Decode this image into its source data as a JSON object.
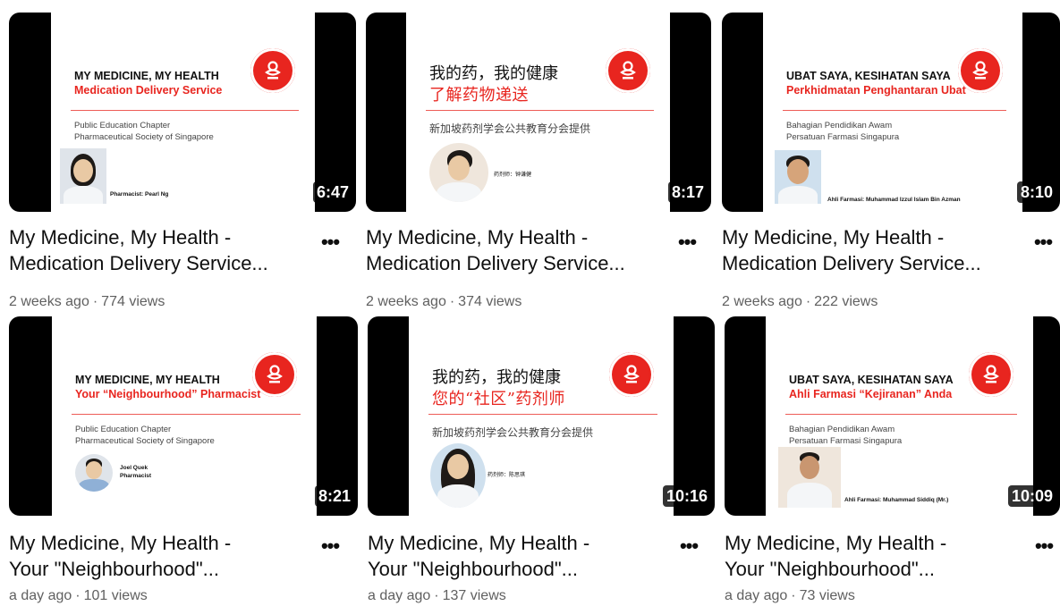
{
  "videos": [
    {
      "title_l1": "My Medicine, My Health -",
      "title_l2": "Medication Delivery Service...",
      "age": "2 weeks ago",
      "views": "774 views",
      "duration": "6:47",
      "thumbnail": {
        "heading": "MY MEDICINE, MY HEALTH",
        "subheading": "Medication Delivery Service",
        "org_line1": "Public Education Chapter",
        "org_line2": "Pharmaceutical Society of Singapore",
        "caption": "Pharmacist: Pearl Ng",
        "caption2": ""
      }
    },
    {
      "title_l1": "My Medicine, My Health -",
      "title_l2": "Medication Delivery Service...",
      "age": "2 weeks ago",
      "views": "374 views",
      "duration": "8:17",
      "thumbnail": {
        "heading": "我的药，我的健康",
        "subheading": "了解药物递送",
        "org_line1": "新加坡药剂学会公共教育分会提供",
        "org_line2": "",
        "caption": "药剂师：钟谦健",
        "caption2": ""
      }
    },
    {
      "title_l1": "My Medicine, My Health -",
      "title_l2": "Medication Delivery Service...",
      "age": "2 weeks ago",
      "views": "222 views",
      "duration": "8:10",
      "thumbnail": {
        "heading": "UBAT SAYA, KESIHATAN SAYA",
        "subheading": "Perkhidmatan Penghantaran Ubat",
        "org_line1": "Bahagian Pendidikan Awam",
        "org_line2": "Persatuan Farmasi Singapura",
        "caption": "Ahli Farmasi: Muhammad Izzul Islam Bin Azman",
        "caption2": ""
      }
    },
    {
      "title_l1": "My Medicine, My Health -",
      "title_l2": "Your \"Neighbourhood\"...",
      "age": "a day ago",
      "views": "101 views",
      "duration": "8:21",
      "thumbnail": {
        "heading": "MY MEDICINE, MY HEALTH",
        "subheading": "Your “Neighbourhood” Pharmacist",
        "org_line1": "Public Education Chapter",
        "org_line2": "Pharmaceutical Society of Singapore",
        "caption": "Joel Quek",
        "caption2": "Pharmacist"
      }
    },
    {
      "title_l1": "My Medicine, My Health -",
      "title_l2": "Your \"Neighbourhood\"...",
      "age": "a day ago",
      "views": "137 views",
      "duration": "10:16",
      "thumbnail": {
        "heading": "我的药，我的健康",
        "subheading": "您的“社区”药剂师",
        "org_line1": "新加坡药剂学会公共教育分会提供",
        "org_line2": "",
        "caption": "药剂师：陈思琪",
        "caption2": ""
      }
    },
    {
      "title_l1": "My Medicine, My Health -",
      "title_l2": "Your \"Neighbourhood\"...",
      "age": "a day ago",
      "views": "73 views",
      "duration": "10:09",
      "thumbnail": {
        "heading": "UBAT SAYA, KESIHATAN SAYA",
        "subheading": "Ahli Farmasi “Kejiranan” Anda",
        "org_line1": "Bahagian Pendidikan Awam",
        "org_line2": "Persatuan Farmasi Singapura",
        "caption": "Ahli Farmasi: Muhammad Siddiq (Mr.)",
        "caption2": ""
      }
    }
  ],
  "more_icon": "more-vert-icon",
  "separator": "·",
  "logo_icon": "society-logo-icon",
  "colors": {
    "accent": "#e8251f",
    "title_text": "#0f0f0f",
    "meta_text": "#606060"
  }
}
